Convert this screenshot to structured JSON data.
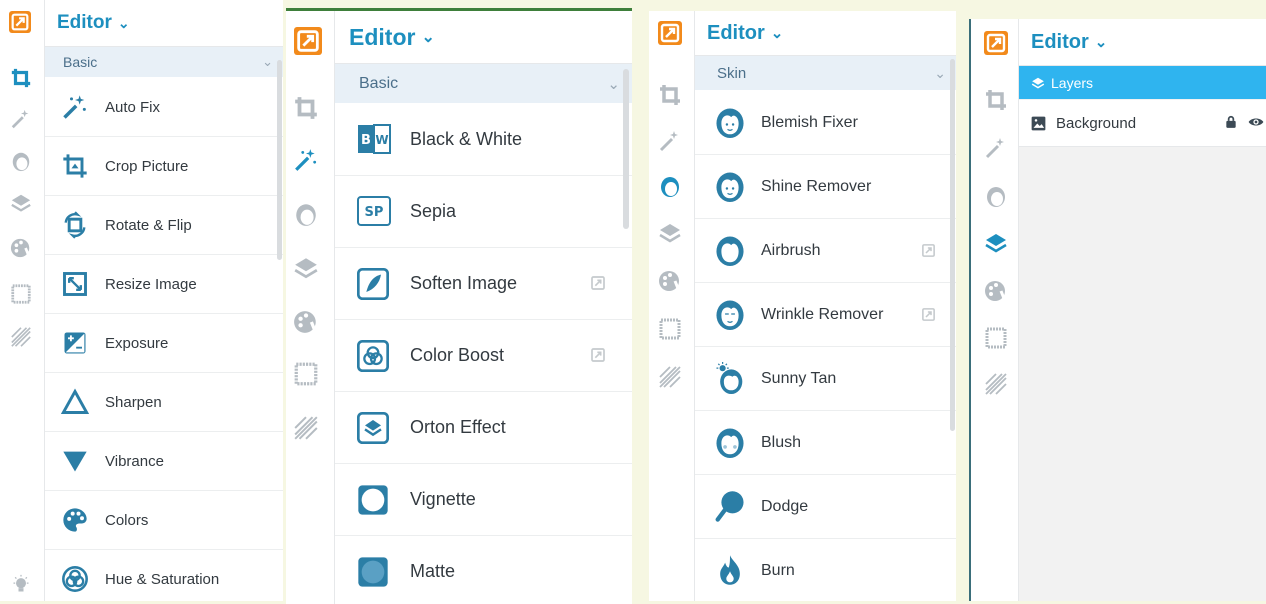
{
  "colors": {
    "accent": "#1d8fbf",
    "logo": "#f28a1b",
    "selected_layer": "#2fb4ef"
  },
  "panels": [
    {
      "app_title": "Editor",
      "section": "Basic",
      "items": [
        {
          "label": "Auto Fix",
          "icon": "magic-wand-icon"
        },
        {
          "label": "Crop Picture",
          "icon": "crop-picture-icon"
        },
        {
          "label": "Rotate & Flip",
          "icon": "rotate-flip-icon"
        },
        {
          "label": "Resize Image",
          "icon": "resize-icon"
        },
        {
          "label": "Exposure",
          "icon": "exposure-icon"
        },
        {
          "label": "Sharpen",
          "icon": "sharpen-triangle-icon"
        },
        {
          "label": "Vibrance",
          "icon": "vibrance-triangle-icon"
        },
        {
          "label": "Colors",
          "icon": "palette-icon"
        },
        {
          "label": "Hue & Saturation",
          "icon": "hue-saturation-icon"
        }
      ],
      "bottom_icon": "lightbulb-icon"
    },
    {
      "app_title": "Editor",
      "section": "Basic",
      "items": [
        {
          "label": "Black & White",
          "icon": "black-white-icon",
          "badge": "BW"
        },
        {
          "label": "Sepia",
          "icon": "sepia-icon",
          "badge": "SP"
        },
        {
          "label": "Soften Image",
          "icon": "soften-icon",
          "premium": true
        },
        {
          "label": "Color Boost",
          "icon": "color-boost-icon",
          "premium": true
        },
        {
          "label": "Orton Effect",
          "icon": "orton-effect-icon"
        },
        {
          "label": "Vignette",
          "icon": "vignette-icon"
        },
        {
          "label": "Matte",
          "icon": "matte-icon"
        }
      ]
    },
    {
      "app_title": "Editor",
      "section": "Skin",
      "items": [
        {
          "label": "Blemish Fixer",
          "icon": "face-icon"
        },
        {
          "label": "Shine Remover",
          "icon": "face-icon"
        },
        {
          "label": "Airbrush",
          "icon": "face-icon",
          "premium": true
        },
        {
          "label": "Wrinkle Remover",
          "icon": "face-icon",
          "premium": true
        },
        {
          "label": "Sunny Tan",
          "icon": "face-sun-icon"
        },
        {
          "label": "Blush",
          "icon": "face-icon"
        },
        {
          "label": "Dodge",
          "icon": "dodge-icon"
        },
        {
          "label": "Burn",
          "icon": "flame-icon"
        }
      ]
    },
    {
      "app_title": "Editor",
      "layers_header": "Layers",
      "layers": [
        {
          "label": "Background",
          "icon": "image-icon",
          "locked": true,
          "visible": true
        }
      ]
    }
  ],
  "rail_icons": [
    "crop-tool-icon",
    "magic-tool-icon",
    "face-tool-icon",
    "layers-tool-icon",
    "paint-tool-icon",
    "frame-tool-icon",
    "texture-tool-icon"
  ]
}
